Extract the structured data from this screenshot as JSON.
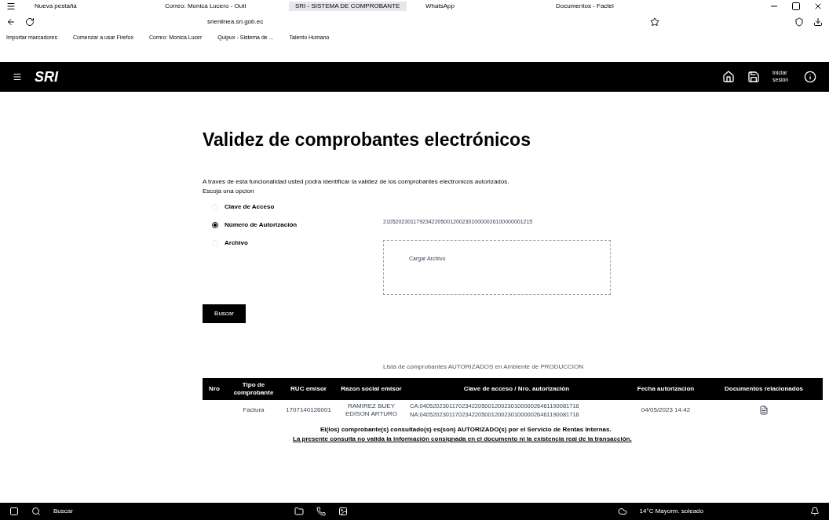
{
  "browser": {
    "tabs": [
      {
        "title": "Nueva pestaña",
        "selected": false
      },
      {
        "title": "Correo: Monica Lucero - Outl",
        "selected": false
      },
      {
        "title": "SRI - SISTEMA DE COMPROBANTE",
        "selected": true
      },
      {
        "title": "WhatsApp",
        "selected": false
      },
      {
        "title": "Documentos - Factel",
        "selected": false
      }
    ],
    "url": "srienlinea.sri.gob.ec",
    "bookmarks": [
      "Importar marcadores",
      "Comenzar a usar Firefox",
      "Correo: Monica Lucer",
      "Quipux - Sistema de ...",
      "Talento Humano"
    ]
  },
  "header": {
    "logo": "SRI",
    "login": "Iniciar sesión"
  },
  "page": {
    "title": "Validez de comprobantes electrónicos",
    "intro": "A traves de esta funcionalidad usted podra identificar la validez de los comprobantes electronicos autorizados.",
    "prompt": "Escoja una opcion",
    "options": [
      {
        "label": "Clave de Acceso",
        "selected": false
      },
      {
        "label": "Número de Autorización",
        "selected": true
      },
      {
        "label": "Archivo",
        "selected": false
      }
    ],
    "number_value": "2105202301179234220500120023010000026100000001215",
    "file_label": "Cargar Archivo",
    "search_button": "Buscar",
    "caption": "Lista de comprobantes AUTORIZADOS en Ambiente de PRODUCCION",
    "columns": [
      "Nro",
      "Tipo de comprobante",
      "RUC emisor",
      "Razon social emisor",
      "Clave de acceso / Nro. autorización",
      "Fecha autorizacion",
      "Documentos relacionados"
    ],
    "rows": [
      {
        "tipo": "Factura",
        "ruc": "1707140126001",
        "razon": "RAMIREZ BUEY EDISON ARTURO",
        "clave": [
          "CA:0405202301170234220500120023010000026461190081716",
          "NA:0405202301170234220500120023010000026461190081716"
        ],
        "fecha": "04/05/2023 14:42"
      }
    ],
    "result": "El(los) comprobante(s) consultado(s) es(son) AUTORIZADO(s) por el Servicio de Rentas Internas.",
    "disclaimer": "La presente consulta no valida la información consignada en el documento ni la existencia real de la transacción."
  },
  "taskbar": {
    "search": "Buscar",
    "weather": "14°C Mayorm. soleado"
  }
}
